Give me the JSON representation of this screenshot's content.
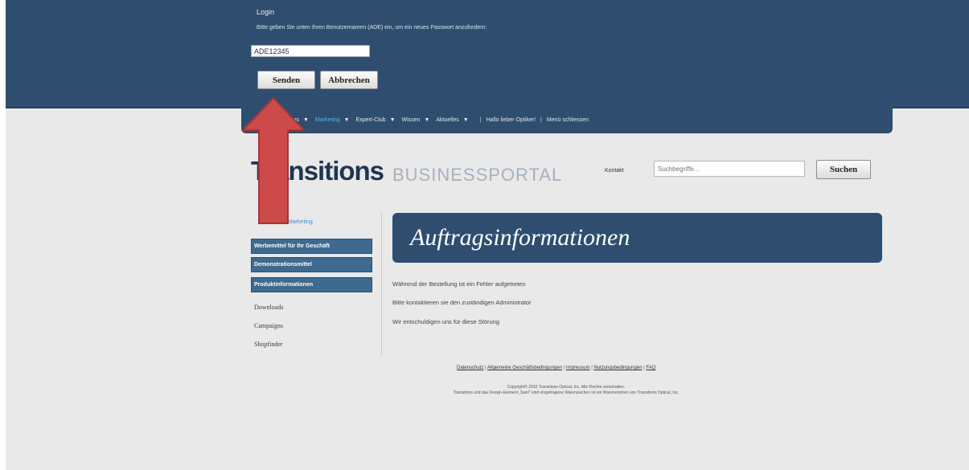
{
  "login": {
    "title": "Login",
    "hint": "Bitte geben Sie unten Ihren Benutzernamen (ADE) ein, um ein neues Passwort anzufordern:",
    "username_value": "ADE12345",
    "send_label": "Senden",
    "cancel_label": "Abbrechen"
  },
  "nav": {
    "items": [
      {
        "label": "Transitions",
        "has_caret": true
      },
      {
        "label": "Marketing",
        "has_caret": true,
        "active": true
      },
      {
        "label": "Expert-Club",
        "has_caret": true
      },
      {
        "label": "Wissen",
        "has_caret": true
      },
      {
        "label": "Aktuelles",
        "has_caret": true
      }
    ],
    "greeting": "Hallo lieber Optiker!",
    "close_menu": "Menü schliessen"
  },
  "header": {
    "logo_text": "Transitions",
    "logo_sub": "BUSINESSPORTAL",
    "kontakt": "Kontakt",
    "search_placeholder": "Suchbegriffe...",
    "search_button": "Suchen"
  },
  "sidebar": {
    "breadcrumb": "Marketing",
    "buttons": [
      "Werbemittel für Ihr Geschäft",
      "Demonstrationsmittel",
      "Produktinformationen"
    ],
    "links": [
      "Downloads",
      "Campaigns",
      "Shopfinder"
    ]
  },
  "main": {
    "headline": "Auftragsinformationen",
    "messages": [
      "Während der Bestellung ist ein Fehler aufgetreten",
      "Bitte kontaktieren sie den zuständigen Administrator",
      "Wir entschuldigen uns für diese Störung"
    ]
  },
  "footer": {
    "links": [
      "Datenschutz",
      "Allgemeine Geschäftsbedingungen",
      "Impressum",
      "Nutzungsbedingungen",
      "FAQ"
    ],
    "copyright_line1": "Copyright© 2010 Transitions Optical, Inc. Alle Rechte vorbehalten.",
    "copyright_line2": "Transitions und das Design-Element „Swirl\" sind eingetragene Warenzeichen ist ein Warenzeichen von Transitions Optical, Inc."
  },
  "annotation": {
    "arrow_color": "#cc4a4a",
    "icon": "up-arrow-icon"
  }
}
